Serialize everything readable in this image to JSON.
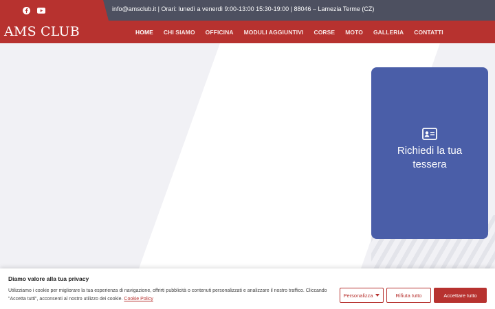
{
  "topbar": {
    "info": "info@amsclub.it | Orari: lunedì a venerdì 9:00-13:00 15:30-19:00 | 88046 – Lamezia Terme (CZ)",
    "social": [
      {
        "icon": "facebook-icon"
      },
      {
        "icon": "youtube-icon"
      }
    ]
  },
  "header": {
    "logo": "AMS CLUB",
    "nav": [
      {
        "label": "HOME",
        "active": true
      },
      {
        "label": "CHI SIAMO"
      },
      {
        "label": "OFFICINA"
      },
      {
        "label": "MODULI AGGIUNTIVI"
      },
      {
        "label": "CORSE"
      },
      {
        "label": "MOTO"
      },
      {
        "label": "GALLERIA"
      },
      {
        "label": "CONTATTI"
      }
    ]
  },
  "card": {
    "icon": "id-card-icon",
    "label": "Richiedi la tua tessera"
  },
  "cookie": {
    "title": "Diamo valore alla tua privacy",
    "text": "Utilizziamo i cookie per migliorare la tua esperienza di navigazione, offrirti pubblicità o contenuti personalizzati e analizzare il nostro traffico. Cliccando \"Accetta tutti\", acconsenti al nostro utilizzo dei cookie.",
    "link": "Cookie Policy",
    "buttons": {
      "customize": "Personalizza",
      "refuse": "Rifiuta tutto",
      "accept": "Accettare tutto"
    }
  },
  "colors": {
    "brand": "#b7322f",
    "topbar_dark": "#4d5060",
    "card": "#4a5ea8"
  }
}
